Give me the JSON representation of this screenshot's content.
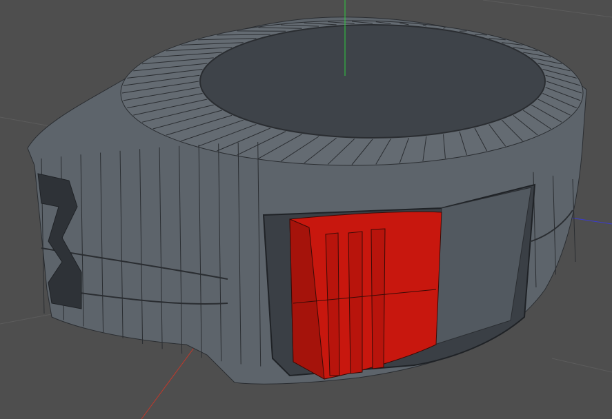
{
  "viewport": {
    "colors": {
      "background": "#4e4e4e",
      "grid": "#5c5c5c",
      "object": "#5d646b",
      "object_dark": "#3e4349",
      "opening": "#2e3237",
      "selection": "#c8170e",
      "selection_shade": "#a5130b",
      "axis_x": "#c0392b",
      "axis_y": "#2ecc40",
      "axis_z": "#3b3bd0",
      "wire": "#2a2d31"
    }
  }
}
